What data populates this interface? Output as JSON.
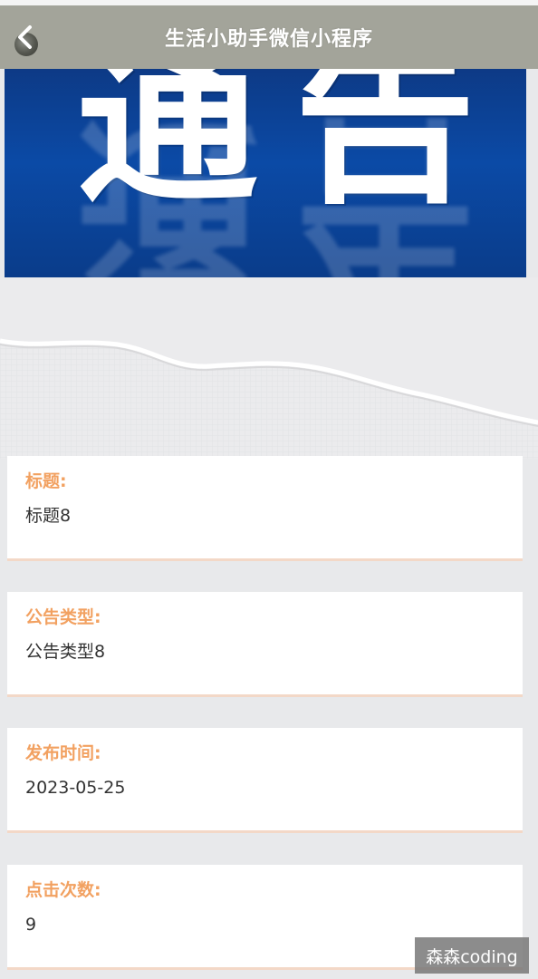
{
  "navbar": {
    "title": "生活小助手微信小程序",
    "back_icon": "back-arrow-icon"
  },
  "banner": {
    "text": "通告",
    "accent": "#0b4aa6"
  },
  "detail": {
    "title_label": "标题:",
    "title_value": "标题8",
    "type_label": "公告类型:",
    "type_value": "公告类型8",
    "time_label": "发布时间:",
    "time_value": "2023-05-25",
    "clicks_label": "点击次数:",
    "clicks_value": "9"
  },
  "colors": {
    "label": "#f2a161",
    "navbar": "#a3a49a",
    "card_border": "#f3d8c7"
  },
  "watermark": "森森coding"
}
